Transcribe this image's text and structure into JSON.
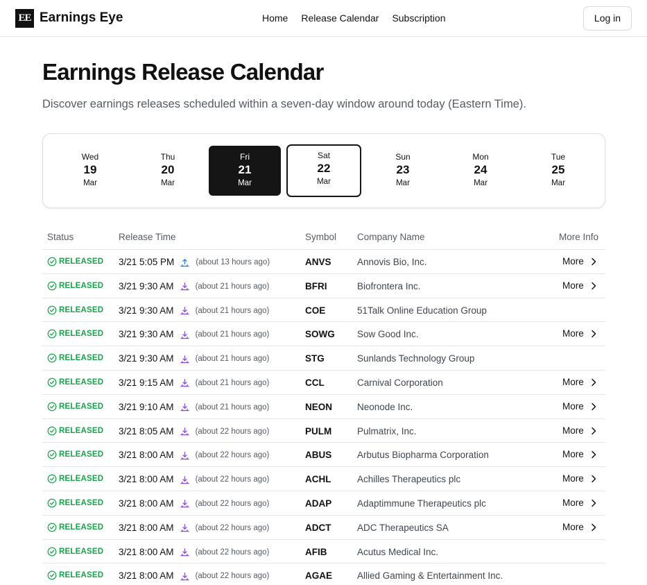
{
  "header": {
    "logo": "EE",
    "brand": "Earnings Eye",
    "nav": [
      "Home",
      "Release Calendar",
      "Subscription"
    ],
    "login": "Log in"
  },
  "page": {
    "title": "Earnings Release Calendar",
    "subtitle": "Discover earnings releases scheduled within a seven-day window around today (Eastern Time)."
  },
  "days": [
    {
      "dow": "Wed",
      "num": "19",
      "mon": "Mar",
      "state": "normal"
    },
    {
      "dow": "Thu",
      "num": "20",
      "mon": "Mar",
      "state": "normal"
    },
    {
      "dow": "Fri",
      "num": "21",
      "mon": "Mar",
      "state": "selected"
    },
    {
      "dow": "Sat",
      "num": "22",
      "mon": "Mar",
      "state": "today"
    },
    {
      "dow": "Sun",
      "num": "23",
      "mon": "Mar",
      "state": "normal"
    },
    {
      "dow": "Mon",
      "num": "24",
      "mon": "Mar",
      "state": "normal"
    },
    {
      "dow": "Tue",
      "num": "25",
      "mon": "Mar",
      "state": "normal"
    }
  ],
  "table": {
    "headers": {
      "status": "Status",
      "time": "Release Time",
      "symbol": "Symbol",
      "company": "Company Name",
      "more": "More Info"
    },
    "rows": [
      {
        "status": "RELEASED",
        "time": "3/21 5:05 PM",
        "icon": "after-market-icon",
        "ago": "(about 13 hours ago)",
        "symbol": "ANVS",
        "company": "Annovis Bio, Inc.",
        "more": "More"
      },
      {
        "status": "RELEASED",
        "time": "3/21 9:30 AM",
        "icon": "pre-market-icon",
        "ago": "(about 21 hours ago)",
        "symbol": "BFRI",
        "company": "Biofrontera Inc.",
        "more": "More"
      },
      {
        "status": "RELEASED",
        "time": "3/21 9:30 AM",
        "icon": "pre-market-icon",
        "ago": "(about 21 hours ago)",
        "symbol": "COE",
        "company": "51Talk Online Education Group",
        "more": ""
      },
      {
        "status": "RELEASED",
        "time": "3/21 9:30 AM",
        "icon": "pre-market-icon",
        "ago": "(about 21 hours ago)",
        "symbol": "SOWG",
        "company": "Sow Good Inc.",
        "more": "More"
      },
      {
        "status": "RELEASED",
        "time": "3/21 9:30 AM",
        "icon": "pre-market-icon",
        "ago": "(about 21 hours ago)",
        "symbol": "STG",
        "company": "Sunlands Technology Group",
        "more": ""
      },
      {
        "status": "RELEASED",
        "time": "3/21 9:15 AM",
        "icon": "pre-market-icon",
        "ago": "(about 21 hours ago)",
        "symbol": "CCL",
        "company": "Carnival Corporation",
        "more": "More"
      },
      {
        "status": "RELEASED",
        "time": "3/21 9:10 AM",
        "icon": "pre-market-icon",
        "ago": "(about 21 hours ago)",
        "symbol": "NEON",
        "company": "Neonode Inc.",
        "more": "More"
      },
      {
        "status": "RELEASED",
        "time": "3/21 8:05 AM",
        "icon": "pre-market-icon",
        "ago": "(about 22 hours ago)",
        "symbol": "PULM",
        "company": "Pulmatrix, Inc.",
        "more": "More"
      },
      {
        "status": "RELEASED",
        "time": "3/21 8:00 AM",
        "icon": "pre-market-icon",
        "ago": "(about 22 hours ago)",
        "symbol": "ABUS",
        "company": "Arbutus Biopharma Corporation",
        "more": "More"
      },
      {
        "status": "RELEASED",
        "time": "3/21 8:00 AM",
        "icon": "pre-market-icon",
        "ago": "(about 22 hours ago)",
        "symbol": "ACHL",
        "company": "Achilles Therapeutics plc",
        "more": "More"
      },
      {
        "status": "RELEASED",
        "time": "3/21 8:00 AM",
        "icon": "pre-market-icon",
        "ago": "(about 22 hours ago)",
        "symbol": "ADAP",
        "company": "Adaptimmune Therapeutics plc",
        "more": "More"
      },
      {
        "status": "RELEASED",
        "time": "3/21 8:00 AM",
        "icon": "pre-market-icon",
        "ago": "(about 22 hours ago)",
        "symbol": "ADCT",
        "company": "ADC Therapeutics SA",
        "more": "More"
      },
      {
        "status": "RELEASED",
        "time": "3/21 8:00 AM",
        "icon": "pre-market-icon",
        "ago": "(about 22 hours ago)",
        "symbol": "AFIB",
        "company": "Acutus Medical Inc.",
        "more": ""
      },
      {
        "status": "RELEASED",
        "time": "3/21 8:00 AM",
        "icon": "pre-market-icon",
        "ago": "(about 22 hours ago)",
        "symbol": "AGAE",
        "company": "Allied Gaming & Entertainment Inc.",
        "more": ""
      }
    ]
  },
  "colors": {
    "released": "#16a34a",
    "after_market": "#2f80d8",
    "pre_market": "#8b4fd6",
    "selected_day_bg": "#151515"
  }
}
